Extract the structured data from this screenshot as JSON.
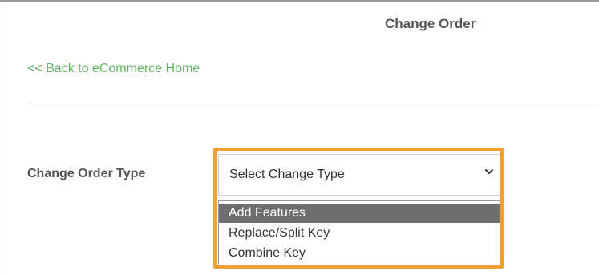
{
  "page": {
    "title": "Change Order",
    "back_link": "<< Back to eCommerce Home"
  },
  "form": {
    "change_type_label": "Change Order Type",
    "change_type_select": {
      "selected_value": "Select Change Type",
      "options": [
        {
          "label": "Add Features",
          "highlighted": true
        },
        {
          "label": "Replace/Split Key",
          "highlighted": false
        },
        {
          "label": "Combine Key",
          "highlighted": false
        }
      ]
    }
  },
  "colors": {
    "link": "#5cb85c",
    "highlight_border": "#f0a030",
    "option_highlight": "#6e6e6e",
    "label_text": "#555555"
  },
  "icons": {
    "select_arrow": "chevron-down-icon"
  }
}
